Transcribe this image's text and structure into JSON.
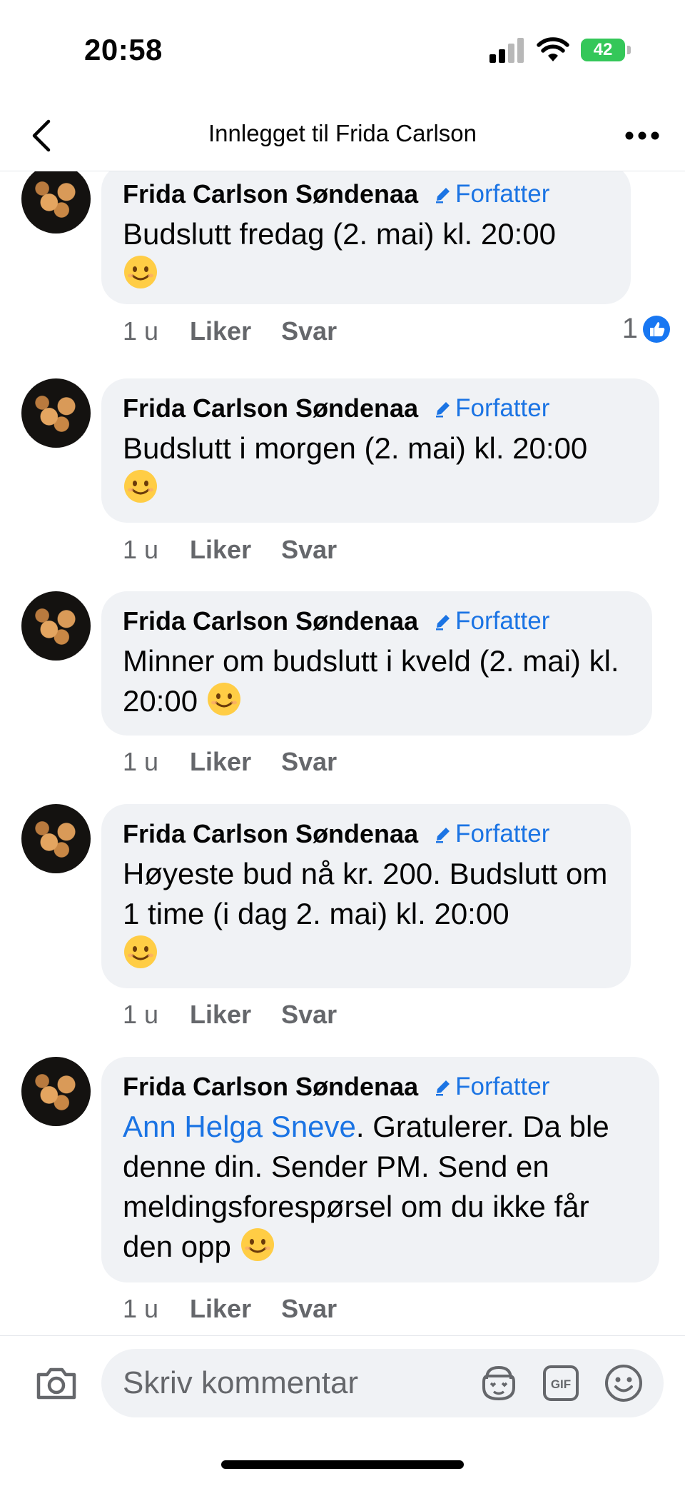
{
  "status_bar": {
    "time": "20:58",
    "battery": "42"
  },
  "header": {
    "title": "Innlegget til Frida Carlson"
  },
  "comments": [
    {
      "author": "Frida Carlson Søndenaa",
      "badge": "Forfatter",
      "text": "Budslutt fredag (2. mai) kl. 20:00",
      "time": "1 u",
      "like_label": "Liker",
      "reply_label": "Svar",
      "reaction_count": "1"
    },
    {
      "author": "Frida Carlson Søndenaa",
      "badge": "Forfatter",
      "text": "Budslutt i morgen (2. mai) kl. 20:00",
      "time": "1 u",
      "like_label": "Liker",
      "reply_label": "Svar"
    },
    {
      "author": "Frida Carlson Søndenaa",
      "badge": "Forfatter",
      "text": "Minner om budslutt i kveld (2. mai) kl. 20:00",
      "time": "1 u",
      "like_label": "Liker",
      "reply_label": "Svar"
    },
    {
      "author": "Frida Carlson Søndenaa",
      "badge": "Forfatter",
      "text": "Høyeste bud nå kr. 200. Budslutt om 1 time (i dag 2. mai) kl. 20:00",
      "time": "1 u",
      "like_label": "Liker",
      "reply_label": "Svar"
    },
    {
      "author": "Frida Carlson Søndenaa",
      "badge": "Forfatter",
      "mention": "Ann Helga Sneve",
      "text": ". Gratulerer. Da ble denne din. Sender PM. Send en meldingsforespørsel om du ikke får den opp",
      "time": "1 u",
      "like_label": "Liker",
      "reply_label": "Svar"
    }
  ],
  "composer": {
    "placeholder": "Skriv kommentar"
  },
  "colors": {
    "link_blue": "#1b74e4",
    "bubble_bg": "#f0f2f5",
    "meta_gray": "#65676b",
    "battery_green": "#34c759"
  },
  "icons": [
    "back-chevron-icon",
    "more-dots-icon",
    "pencil-icon",
    "smiley-emoji-icon",
    "like-thumb-icon",
    "camera-icon",
    "avatar-sticker-icon",
    "gif-icon",
    "emoji-icon"
  ]
}
